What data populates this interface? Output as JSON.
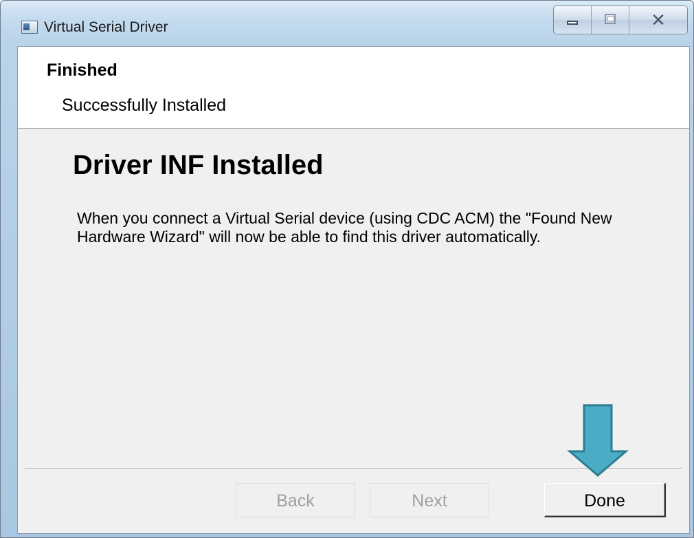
{
  "window": {
    "title": "Virtual Serial Driver",
    "close_glyph": "✕"
  },
  "header": {
    "title": "Finished",
    "subtitle": "Successfully Installed"
  },
  "main": {
    "heading": "Driver INF Installed",
    "body": "When you connect a Virtual Serial device (using CDC ACM) the \"Found New Hardware Wizard\" will now be able to find this driver automatically."
  },
  "buttons": {
    "back_label": "Back",
    "next_label": "Next",
    "done_label": "Done"
  },
  "colors": {
    "arrow_fill": "#4bacc6",
    "arrow_stroke": "#2c7d92"
  }
}
